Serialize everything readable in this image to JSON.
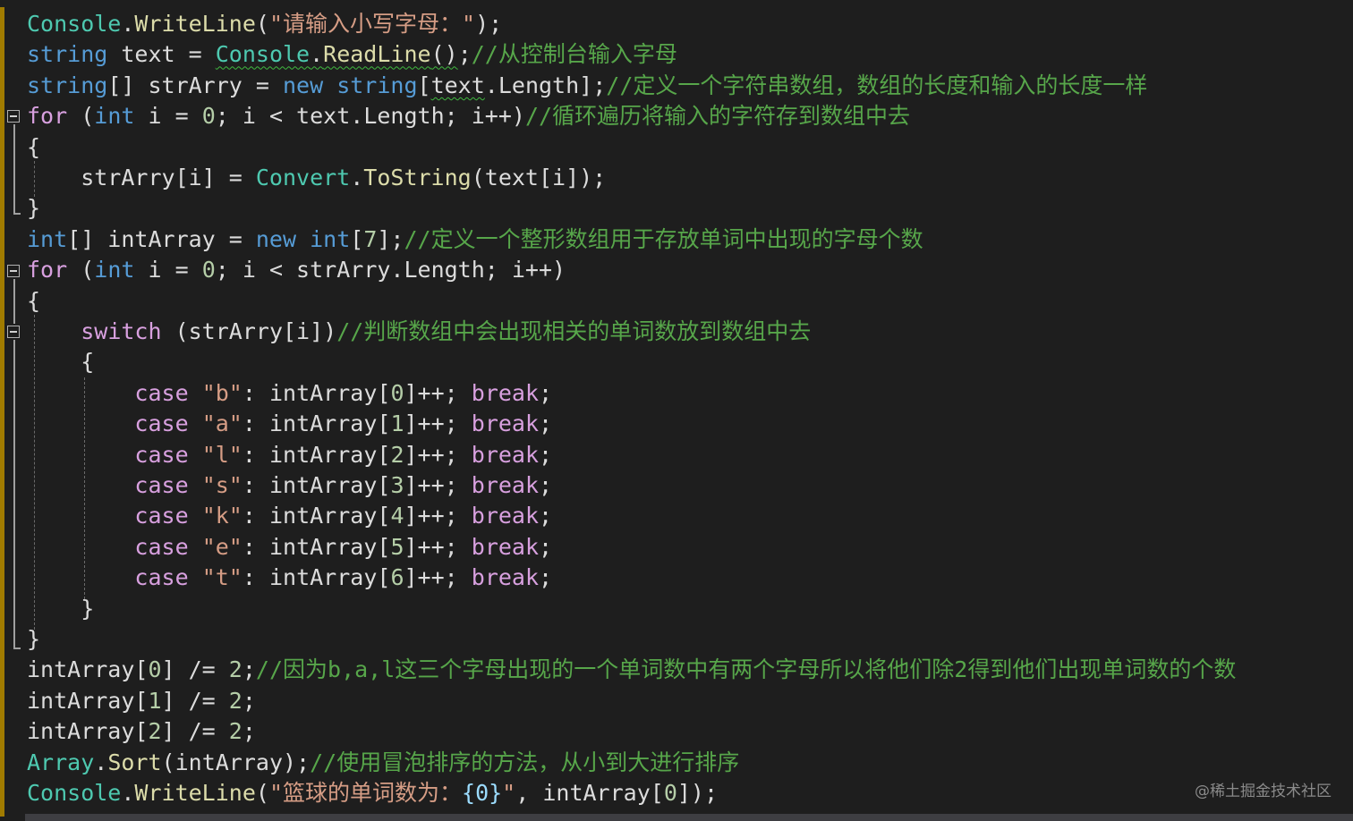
{
  "lines": [
    {
      "tokens": [
        {
          "t": "Console",
          "c": "cls"
        },
        {
          "t": ".",
          "c": "pl"
        },
        {
          "t": "WriteLine",
          "c": "mth"
        },
        {
          "t": "(",
          "c": "pl"
        },
        {
          "t": "\"请输入小写字母：\"",
          "c": "str"
        },
        {
          "t": ");",
          "c": "pl"
        }
      ]
    },
    {
      "tokens": [
        {
          "t": "string",
          "c": "kw"
        },
        {
          "t": " text = ",
          "c": "pl"
        },
        {
          "t": "Console",
          "c": "cls squig"
        },
        {
          "t": ".",
          "c": "pl squig"
        },
        {
          "t": "ReadLine",
          "c": "mth squig"
        },
        {
          "t": "()",
          "c": "pl squig"
        },
        {
          "t": ";",
          "c": "pl"
        },
        {
          "t": "//从控制台输入字母",
          "c": "cmt"
        }
      ]
    },
    {
      "tokens": [
        {
          "t": "string",
          "c": "kw"
        },
        {
          "t": "[] strArry = ",
          "c": "pl"
        },
        {
          "t": "new",
          "c": "kw"
        },
        {
          "t": " ",
          "c": "pl"
        },
        {
          "t": "string",
          "c": "kw"
        },
        {
          "t": "[",
          "c": "pl"
        },
        {
          "t": "text",
          "c": "pl squig"
        },
        {
          "t": ".Length];",
          "c": "pl"
        },
        {
          "t": "//定义一个字符串数组，数组的长度和输入的长度一样",
          "c": "cmt"
        }
      ]
    },
    {
      "tokens": [
        {
          "t": "for",
          "c": "kwp"
        },
        {
          "t": " (",
          "c": "pl"
        },
        {
          "t": "int",
          "c": "kw"
        },
        {
          "t": " i = ",
          "c": "pl"
        },
        {
          "t": "0",
          "c": "num"
        },
        {
          "t": "; i < text.Length; i++)",
          "c": "pl"
        },
        {
          "t": "//循环遍历将输入的字符存到数组中去",
          "c": "cmt"
        }
      ]
    },
    {
      "tokens": [
        {
          "t": "{",
          "c": "pl"
        }
      ]
    },
    {
      "tokens": [
        {
          "t": "    strArry[i] = ",
          "c": "pl"
        },
        {
          "t": "Convert",
          "c": "cls"
        },
        {
          "t": ".",
          "c": "pl"
        },
        {
          "t": "ToString",
          "c": "mth"
        },
        {
          "t": "(text[i]);",
          "c": "pl"
        }
      ]
    },
    {
      "tokens": [
        {
          "t": "}",
          "c": "pl"
        }
      ]
    },
    {
      "tokens": [
        {
          "t": "int",
          "c": "kw"
        },
        {
          "t": "[] intArray = ",
          "c": "pl"
        },
        {
          "t": "new",
          "c": "kw"
        },
        {
          "t": " ",
          "c": "pl"
        },
        {
          "t": "int",
          "c": "kw"
        },
        {
          "t": "[",
          "c": "pl"
        },
        {
          "t": "7",
          "c": "num"
        },
        {
          "t": "];",
          "c": "pl"
        },
        {
          "t": "//定义一个整形数组用于存放单词中出现的字母个数",
          "c": "cmt"
        }
      ]
    },
    {
      "tokens": [
        {
          "t": "for",
          "c": "kwp"
        },
        {
          "t": " (",
          "c": "pl"
        },
        {
          "t": "int",
          "c": "kw"
        },
        {
          "t": " i = ",
          "c": "pl"
        },
        {
          "t": "0",
          "c": "num"
        },
        {
          "t": "; i < strArry.Length; i++)",
          "c": "pl"
        }
      ]
    },
    {
      "tokens": [
        {
          "t": "{",
          "c": "pl"
        }
      ]
    },
    {
      "tokens": [
        {
          "t": "    ",
          "c": "pl"
        },
        {
          "t": "switch",
          "c": "kwp"
        },
        {
          "t": " (strArry[i])",
          "c": "pl"
        },
        {
          "t": "//判断数组中会出现相关的单词数放到数组中去",
          "c": "cmt"
        }
      ]
    },
    {
      "tokens": [
        {
          "t": "    {",
          "c": "pl"
        }
      ]
    },
    {
      "tokens": [
        {
          "t": "        ",
          "c": "pl"
        },
        {
          "t": "case",
          "c": "kwp"
        },
        {
          "t": " ",
          "c": "pl"
        },
        {
          "t": "\"b\"",
          "c": "str"
        },
        {
          "t": ": intArray[",
          "c": "pl"
        },
        {
          "t": "0",
          "c": "num"
        },
        {
          "t": "]++; ",
          "c": "pl"
        },
        {
          "t": "break",
          "c": "kwp"
        },
        {
          "t": ";",
          "c": "pl"
        }
      ]
    },
    {
      "tokens": [
        {
          "t": "        ",
          "c": "pl"
        },
        {
          "t": "case",
          "c": "kwp"
        },
        {
          "t": " ",
          "c": "pl"
        },
        {
          "t": "\"a\"",
          "c": "str"
        },
        {
          "t": ": intArray[",
          "c": "pl"
        },
        {
          "t": "1",
          "c": "num"
        },
        {
          "t": "]++; ",
          "c": "pl"
        },
        {
          "t": "break",
          "c": "kwp"
        },
        {
          "t": ";",
          "c": "pl"
        }
      ]
    },
    {
      "tokens": [
        {
          "t": "        ",
          "c": "pl"
        },
        {
          "t": "case",
          "c": "kwp"
        },
        {
          "t": " ",
          "c": "pl"
        },
        {
          "t": "\"l\"",
          "c": "str"
        },
        {
          "t": ": intArray[",
          "c": "pl"
        },
        {
          "t": "2",
          "c": "num"
        },
        {
          "t": "]++; ",
          "c": "pl"
        },
        {
          "t": "break",
          "c": "kwp"
        },
        {
          "t": ";",
          "c": "pl"
        }
      ]
    },
    {
      "tokens": [
        {
          "t": "        ",
          "c": "pl"
        },
        {
          "t": "case",
          "c": "kwp"
        },
        {
          "t": " ",
          "c": "pl"
        },
        {
          "t": "\"s\"",
          "c": "str"
        },
        {
          "t": ": intArray[",
          "c": "pl"
        },
        {
          "t": "3",
          "c": "num"
        },
        {
          "t": "]++; ",
          "c": "pl"
        },
        {
          "t": "break",
          "c": "kwp"
        },
        {
          "t": ";",
          "c": "pl"
        }
      ]
    },
    {
      "tokens": [
        {
          "t": "        ",
          "c": "pl"
        },
        {
          "t": "case",
          "c": "kwp"
        },
        {
          "t": " ",
          "c": "pl"
        },
        {
          "t": "\"k\"",
          "c": "str"
        },
        {
          "t": ": intArray[",
          "c": "pl"
        },
        {
          "t": "4",
          "c": "num"
        },
        {
          "t": "]++; ",
          "c": "pl"
        },
        {
          "t": "break",
          "c": "kwp"
        },
        {
          "t": ";",
          "c": "pl"
        }
      ]
    },
    {
      "tokens": [
        {
          "t": "        ",
          "c": "pl"
        },
        {
          "t": "case",
          "c": "kwp"
        },
        {
          "t": " ",
          "c": "pl"
        },
        {
          "t": "\"e\"",
          "c": "str"
        },
        {
          "t": ": intArray[",
          "c": "pl"
        },
        {
          "t": "5",
          "c": "num"
        },
        {
          "t": "]++; ",
          "c": "pl"
        },
        {
          "t": "break",
          "c": "kwp"
        },
        {
          "t": ";",
          "c": "pl"
        }
      ]
    },
    {
      "tokens": [
        {
          "t": "        ",
          "c": "pl"
        },
        {
          "t": "case",
          "c": "kwp"
        },
        {
          "t": " ",
          "c": "pl"
        },
        {
          "t": "\"t\"",
          "c": "str"
        },
        {
          "t": ": intArray[",
          "c": "pl"
        },
        {
          "t": "6",
          "c": "num"
        },
        {
          "t": "]++; ",
          "c": "pl"
        },
        {
          "t": "break",
          "c": "kwp"
        },
        {
          "t": ";",
          "c": "pl"
        }
      ]
    },
    {
      "tokens": [
        {
          "t": "    }",
          "c": "pl"
        }
      ]
    },
    {
      "tokens": [
        {
          "t": "}",
          "c": "pl"
        }
      ]
    },
    {
      "tokens": [
        {
          "t": "intArray[",
          "c": "pl"
        },
        {
          "t": "0",
          "c": "num"
        },
        {
          "t": "] /= ",
          "c": "pl"
        },
        {
          "t": "2",
          "c": "num"
        },
        {
          "t": ";",
          "c": "pl"
        },
        {
          "t": "//因为b,a,l这三个字母出现的一个单词数中有两个字母所以将他们除2得到他们出现单词数的个数",
          "c": "cmt"
        }
      ]
    },
    {
      "tokens": [
        {
          "t": "intArray[",
          "c": "pl"
        },
        {
          "t": "1",
          "c": "num"
        },
        {
          "t": "] /= ",
          "c": "pl"
        },
        {
          "t": "2",
          "c": "num"
        },
        {
          "t": ";",
          "c": "pl"
        }
      ]
    },
    {
      "tokens": [
        {
          "t": "intArray[",
          "c": "pl"
        },
        {
          "t": "2",
          "c": "num"
        },
        {
          "t": "] /= ",
          "c": "pl"
        },
        {
          "t": "2",
          "c": "num"
        },
        {
          "t": ";",
          "c": "pl"
        }
      ]
    },
    {
      "tokens": [
        {
          "t": "Array",
          "c": "cls"
        },
        {
          "t": ".",
          "c": "pl"
        },
        {
          "t": "Sort",
          "c": "mth"
        },
        {
          "t": "(intArray);",
          "c": "pl"
        },
        {
          "t": "//使用冒泡排序的方法，从小到大进行排序",
          "c": "cmt"
        }
      ]
    },
    {
      "tokens": [
        {
          "t": "Console",
          "c": "cls"
        },
        {
          "t": ".",
          "c": "pl"
        },
        {
          "t": "WriteLine",
          "c": "mth"
        },
        {
          "t": "(",
          "c": "pl"
        },
        {
          "t": "\"篮球的单词数为：",
          "c": "str"
        },
        {
          "t": "{0}",
          "c": "var"
        },
        {
          "t": "\"",
          "c": "str"
        },
        {
          "t": ", intArray[",
          "c": "pl"
        },
        {
          "t": "0",
          "c": "num"
        },
        {
          "t": "]);",
          "c": "pl"
        }
      ]
    }
  ],
  "watermark": "@稀土掘金技术社区",
  "colors": {
    "background": "#1e1e1e",
    "keyword": "#569cd6",
    "control_keyword": "#d8a0df",
    "type": "#4ec9b0",
    "method": "#dcdcaa",
    "string": "#d69d85",
    "comment": "#57a64a",
    "number": "#b5cea8"
  }
}
